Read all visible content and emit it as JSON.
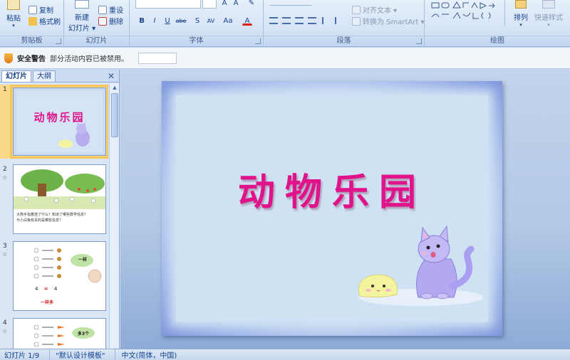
{
  "ribbon": {
    "clipboard": {
      "paste": "粘贴",
      "copy": "复制",
      "format_painter": "格式刷",
      "label": "剪贴板"
    },
    "slides": {
      "new_slide": "新建\n幻灯片",
      "new_slide_line1": "新建",
      "new_slide_line2": "幻灯片 ▾",
      "reset": "重设",
      "delete": "删除",
      "label": "幻灯片"
    },
    "font": {
      "label": "字体",
      "buttons": [
        "B",
        "I",
        "U",
        "abe",
        "S",
        "AV",
        "Aa"
      ]
    },
    "paragraph": {
      "align_text": "对齐文本 ▾",
      "smartart": "转换为 SmartArt ▾",
      "label": "段落"
    },
    "drawing": {
      "arrange": "排列",
      "quick_styles": "快速样式",
      "label": "绘图"
    }
  },
  "security": {
    "title": "安全警告",
    "message": "部分活动内容已被禁用。",
    "options_button": ""
  },
  "left_pane": {
    "tabs": [
      "幻灯片",
      "大纲"
    ],
    "close": "✕",
    "thumbnails": [
      {
        "num": "1",
        "title": "动物乐园"
      },
      {
        "num": "2",
        "anim": "☆",
        "caption_1": "大熊手指着挂了什么？知道了哪些数学信息？",
        "caption_2": "与小白兔有关的是哪些信息？"
      },
      {
        "num": "3",
        "anim": "☆",
        "left": "4",
        "eq": "=",
        "right": "4",
        "bottom": "一样多",
        "bubble": "一样"
      },
      {
        "num": "4",
        "anim": "☆",
        "bubble": "多3个"
      }
    ]
  },
  "slide": {
    "title": "动物乐园"
  },
  "status": {
    "slide_info": "幻灯片 1/9",
    "template": "\"默认设计模板\"",
    "language": "中文(简体，中国)"
  },
  "colors": {
    "title": "#e0138a",
    "accent": "#15428b",
    "selection": "#f7c65a"
  }
}
